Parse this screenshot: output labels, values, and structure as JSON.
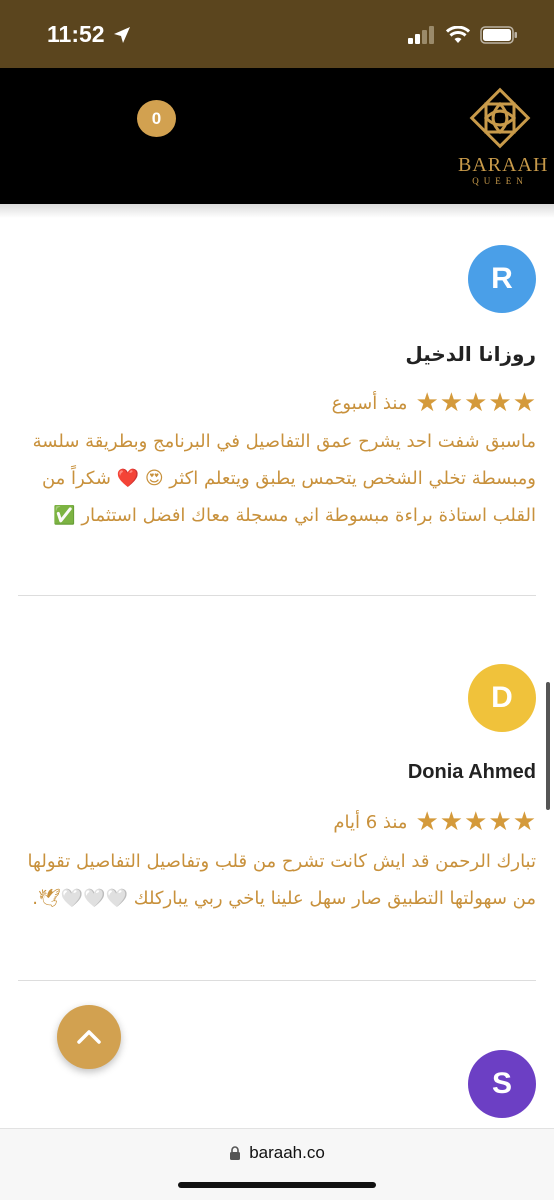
{
  "status_bar": {
    "time": "11:52"
  },
  "header": {
    "cart_count": "0",
    "logo_line1": "BARAAH",
    "logo_line2": "QUEEN",
    "brand_color": "#d2a150"
  },
  "reviews": [
    {
      "avatar_letter": "R",
      "avatar_color": "#4a9fe8",
      "name": "روزانا الدخيل",
      "rating": 5,
      "date": "منذ أسبوع",
      "text": "ماسبق شفت احد يشرح عمق التفاصيل في البرنامج وبطريقة سلسة ومبسطة تخلي الشخص يتحمس يطبق ويتعلم اكثر 😍 ❤️ شكراً من القلب استاذة براءة مبسوطة اني مسجلة معاك افضل استثمار ✅"
    },
    {
      "avatar_letter": "D",
      "avatar_color": "#f0c23b",
      "name": "Donia Ahmed",
      "rating": 5,
      "date": "منذ 6 أيام",
      "text": "تبارك الرحمن قد ايش كانت تشرح من قلب وتفاصيل التفاصيل تقولها من سهولتها التطبيق صار سهل علينا ياخي ربي يباركلك 🤍🤍🤍🕊."
    },
    {
      "avatar_letter": "S",
      "avatar_color": "#6c3fc4"
    }
  ],
  "browser": {
    "url": "baraah.co"
  }
}
